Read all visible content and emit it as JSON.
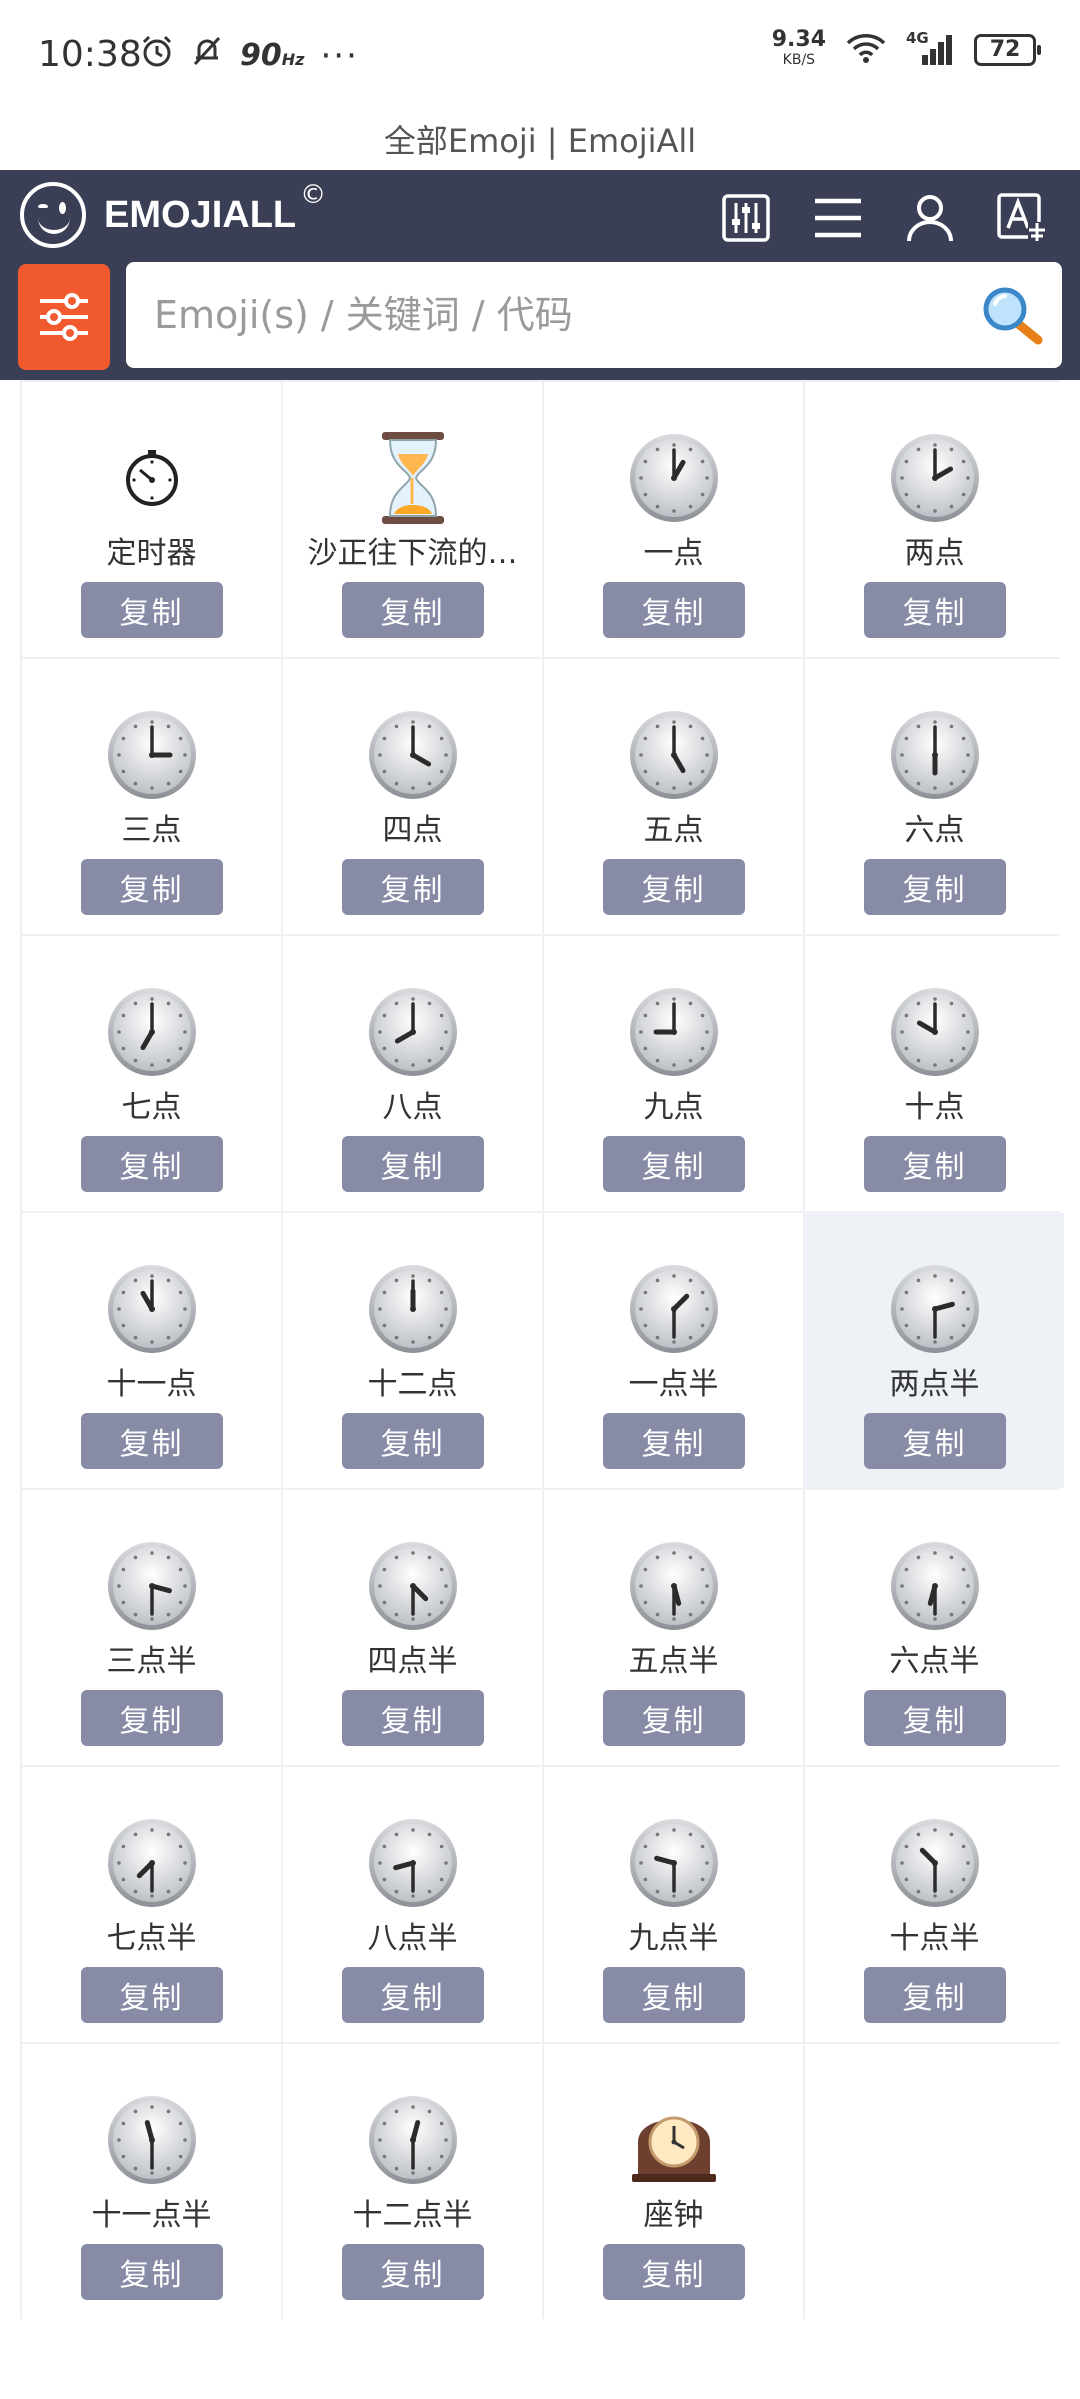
{
  "status_bar": {
    "time": "10:38",
    "refresh_rate": "90",
    "refresh_unit": "Hz",
    "more": "···",
    "net_speed": "9.34",
    "net_unit": "KB/S",
    "network": "4G",
    "battery": "72"
  },
  "page_title": "全部Emoji | EmojiAll",
  "header": {
    "logo_text": "EMOJIALL",
    "logo_mark": "©",
    "search_placeholder": "Emoji(s) / 关键词 / 代码"
  },
  "copy_label": "复制",
  "emojis": [
    {
      "name": "定时器",
      "icon": "timer-clock",
      "time": null
    },
    {
      "name": "沙正往下流的…",
      "icon": "hourglass",
      "time": null
    },
    {
      "name": "一点",
      "icon": "clock",
      "time": [
        1,
        0
      ]
    },
    {
      "name": "两点",
      "icon": "clock",
      "time": [
        2,
        0
      ]
    },
    {
      "name": "三点",
      "icon": "clock",
      "time": [
        3,
        0
      ]
    },
    {
      "name": "四点",
      "icon": "clock",
      "time": [
        4,
        0
      ]
    },
    {
      "name": "五点",
      "icon": "clock",
      "time": [
        5,
        0
      ]
    },
    {
      "name": "六点",
      "icon": "clock",
      "time": [
        6,
        0
      ]
    },
    {
      "name": "七点",
      "icon": "clock",
      "time": [
        7,
        0
      ]
    },
    {
      "name": "八点",
      "icon": "clock",
      "time": [
        8,
        0
      ]
    },
    {
      "name": "九点",
      "icon": "clock",
      "time": [
        9,
        0
      ]
    },
    {
      "name": "十点",
      "icon": "clock",
      "time": [
        10,
        0
      ]
    },
    {
      "name": "十一点",
      "icon": "clock",
      "time": [
        11,
        0
      ]
    },
    {
      "name": "十二点",
      "icon": "clock",
      "time": [
        12,
        0
      ]
    },
    {
      "name": "一点半",
      "icon": "clock",
      "time": [
        1,
        30
      ]
    },
    {
      "name": "两点半",
      "icon": "clock",
      "time": [
        2,
        30
      ]
    },
    {
      "name": "三点半",
      "icon": "clock",
      "time": [
        3,
        30
      ]
    },
    {
      "name": "四点半",
      "icon": "clock",
      "time": [
        4,
        30
      ]
    },
    {
      "name": "五点半",
      "icon": "clock",
      "time": [
        5,
        30
      ]
    },
    {
      "name": "六点半",
      "icon": "clock",
      "time": [
        6,
        30
      ]
    },
    {
      "name": "七点半",
      "icon": "clock",
      "time": [
        7,
        30
      ]
    },
    {
      "name": "八点半",
      "icon": "clock",
      "time": [
        8,
        30
      ]
    },
    {
      "name": "九点半",
      "icon": "clock",
      "time": [
        9,
        30
      ]
    },
    {
      "name": "十点半",
      "icon": "clock",
      "time": [
        10,
        30
      ]
    },
    {
      "name": "十一点半",
      "icon": "clock",
      "time": [
        11,
        30
      ]
    },
    {
      "name": "十二点半",
      "icon": "clock",
      "time": [
        12,
        30
      ]
    },
    {
      "name": "座钟",
      "icon": "mantelpiece-clock",
      "time": null
    }
  ],
  "highlighted_index": 15,
  "colors": {
    "header_bg": "#3b3f55",
    "filter_btn": "#f05a2e",
    "copy_btn": "#878ba6"
  }
}
